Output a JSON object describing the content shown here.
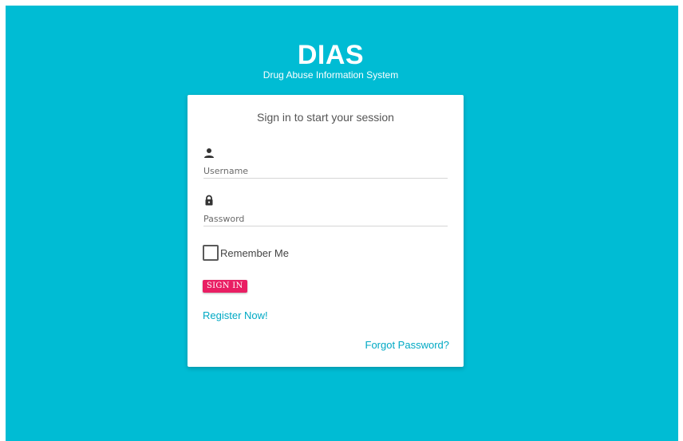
{
  "app": {
    "title": "DIAS",
    "subtitle": "Drug Abuse Information System"
  },
  "login": {
    "message": "Sign in to start your session",
    "username": {
      "icon": "person-icon",
      "placeholder": "Username",
      "value": ""
    },
    "password": {
      "icon": "lock-icon",
      "placeholder": "Password",
      "value": ""
    },
    "remember_label": "Remember Me",
    "remember_checked": false,
    "signin_label": "SIGN IN",
    "register_label": "Register Now!",
    "forgot_label": "Forgot Password?"
  },
  "colors": {
    "background": "#00bcd4",
    "card": "#ffffff",
    "accent_button": "#e91e63",
    "link": "#00a9c4"
  }
}
